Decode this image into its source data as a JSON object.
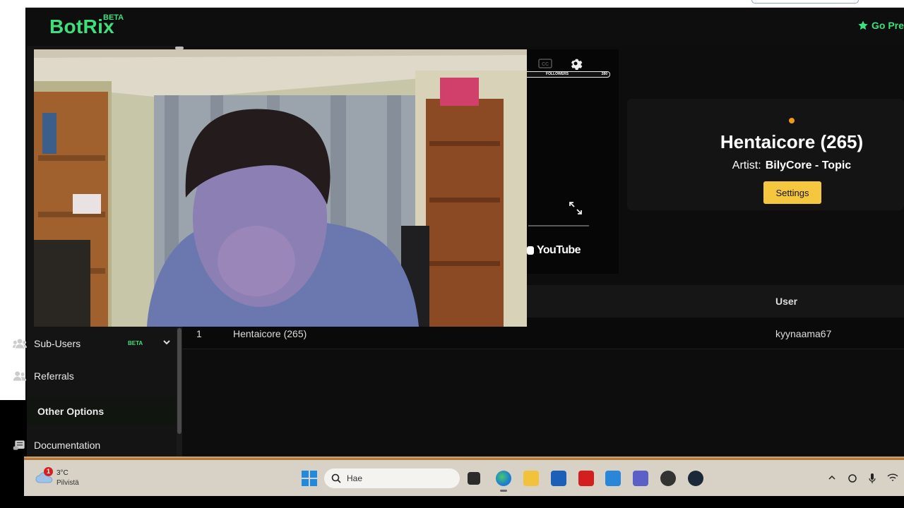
{
  "app": {
    "logo_text": "BotRix",
    "logo_badge": "BETA",
    "premium_label": "Go Pre",
    "brand_color": "#3ee07a"
  },
  "player": {
    "followers_label": "FOLLOWERS",
    "followers_current": "91",
    "followers_goal": "280",
    "followers_progress": 0.2,
    "youtube_label": "YouTube"
  },
  "now_playing": {
    "title": "Hentaicore (265)",
    "artist_label": "Artist:",
    "artist": "BilyCore - Topic",
    "settings_label": "Settings",
    "status_color": "#f09a10"
  },
  "queue": {
    "user_column": "User",
    "rows": [
      {
        "position": "1",
        "title": "Hentaicore (265)",
        "user": "kyynaama67"
      }
    ]
  },
  "sidebar": {
    "items": [
      {
        "label": "Sub-Users",
        "badge": "BETA",
        "icon": "users-icon"
      },
      {
        "label": "Referrals",
        "icon": "user-group-icon"
      }
    ],
    "section": "Other Options",
    "section_items": [
      {
        "label": "Documentation",
        "icon": "scroll-icon"
      }
    ]
  },
  "taskbar": {
    "weather_temp": "3°C",
    "weather_desc": "Pilvistä",
    "weather_badge": "1",
    "search_placeholder": "Hae"
  }
}
